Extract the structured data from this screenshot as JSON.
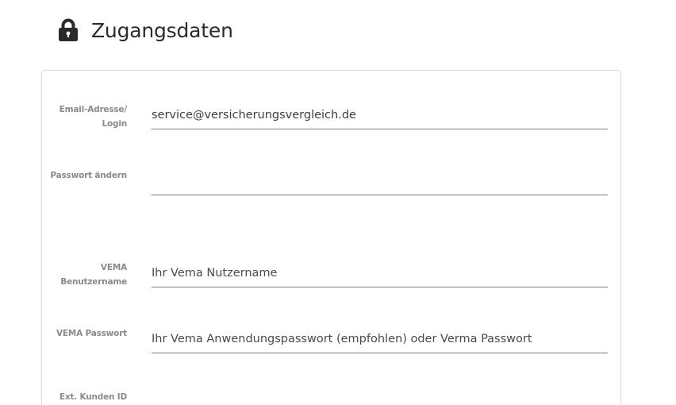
{
  "header": {
    "title": "Zugangsdaten",
    "icon": "lock-icon"
  },
  "form": {
    "email": {
      "label_line1": "Email-Adresse/",
      "label_line2": "Login",
      "value": "service@versicherungsvergleich.de"
    },
    "password_change": {
      "label": "Passwort ändern",
      "value": ""
    },
    "vema_username": {
      "label_line1": "VEMA",
      "label_line2": "Benutzername",
      "placeholder": "Ihr Vema Nutzername"
    },
    "vema_password": {
      "label": "VEMA Passwort",
      "placeholder": "Ihr Vema Anwendungspasswort (empfohlen) oder Verma Passwort"
    },
    "ext_customer_id": {
      "label": "Ext. Kunden ID"
    }
  }
}
